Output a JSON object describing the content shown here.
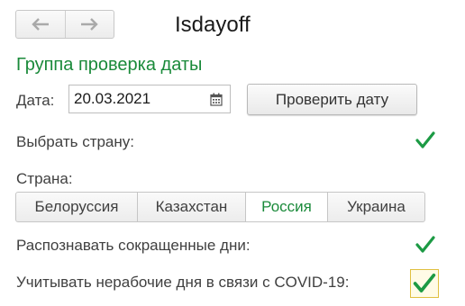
{
  "window": {
    "title": "Isdayoff"
  },
  "nav": {
    "back_icon": "arrow-left-icon",
    "forward_icon": "arrow-right-icon"
  },
  "group": {
    "title": "Группа проверка даты"
  },
  "date": {
    "label": "Дата:",
    "value": "20.03.2021",
    "icon": "calendar-icon"
  },
  "check_button": {
    "label": "Проверить дату"
  },
  "choose_country": {
    "label": "Выбрать страну:",
    "checked": true
  },
  "country": {
    "label": "Страна:",
    "options": [
      "Белоруссия",
      "Казахстан",
      "Россия",
      "Украина"
    ],
    "selected": "Россия"
  },
  "shortened_days": {
    "label": "Распознавать сокращенные дни:",
    "checked": true
  },
  "covid_days": {
    "label": "Учитывать нерабочие дня в связи с COVID-19:",
    "checked": true
  },
  "colors": {
    "accent_green": "#1a8a3a",
    "check_green": "#1c9a44",
    "focus_border": "#e0c040"
  }
}
